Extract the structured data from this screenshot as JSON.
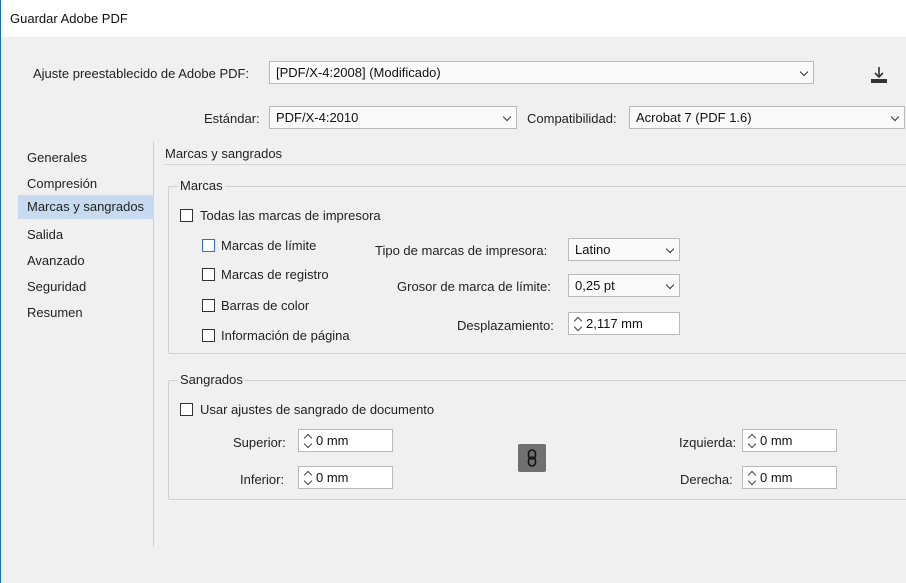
{
  "window": {
    "title": "Guardar Adobe PDF"
  },
  "preset": {
    "label": "Ajuste preestablecido de Adobe PDF:",
    "value": "[PDF/X-4:2008] (Modificado)",
    "save_icon": "save-preset-icon"
  },
  "standard": {
    "label": "Estándar:",
    "value": "PDF/X-4:2010"
  },
  "compat": {
    "label": "Compatibilidad:",
    "value": "Acrobat 7 (PDF 1.6)"
  },
  "sidebar": {
    "items": [
      {
        "label": "Generales",
        "active": false
      },
      {
        "label": "Compresión",
        "active": false
      },
      {
        "label": "Marcas y sangrados",
        "active": true
      },
      {
        "label": "Salida",
        "active": false
      },
      {
        "label": "Avanzado",
        "active": false
      },
      {
        "label": "Seguridad",
        "active": false
      },
      {
        "label": "Resumen",
        "active": false
      }
    ]
  },
  "panel": {
    "title": "Marcas y sangrados"
  },
  "marks": {
    "group_title": "Marcas",
    "all_marks": {
      "label": "Todas las marcas de impresora",
      "checked": false
    },
    "crop": {
      "label": "Marcas de límite",
      "checked": false
    },
    "registration": {
      "label": "Marcas de registro",
      "checked": false
    },
    "color_bars": {
      "label": "Barras de color",
      "checked": false
    },
    "page_info": {
      "label": "Información de página",
      "checked": false
    },
    "type": {
      "label": "Tipo de marcas de impresora:",
      "value": "Latino"
    },
    "weight": {
      "label": "Grosor de marca de límite:",
      "value": "0,25 pt"
    },
    "offset": {
      "label": "Desplazamiento:",
      "value": "2,117 mm"
    }
  },
  "bleeds": {
    "group_title": "Sangrados",
    "use_doc": {
      "label": "Usar ajustes de sangrado de documento",
      "checked": false
    },
    "top": {
      "label": "Superior:",
      "value": "0 mm"
    },
    "bottom": {
      "label": "Inferior:",
      "value": "0 mm"
    },
    "left": {
      "label": "Izquierda:",
      "value": "0 mm"
    },
    "right": {
      "label": "Derecha:",
      "value": "0 mm"
    },
    "link_icon": "chain-link-icon"
  }
}
